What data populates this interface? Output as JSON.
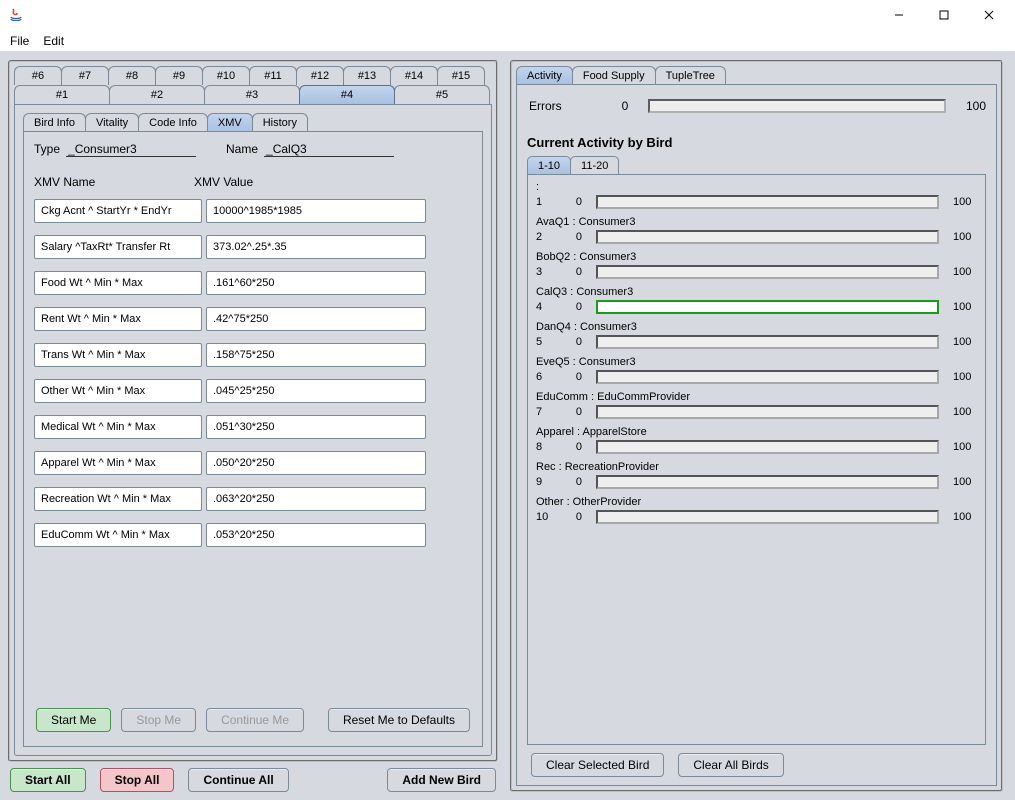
{
  "menu": {
    "file": "File",
    "edit": "Edit"
  },
  "numTabsTop": [
    "#6",
    "#7",
    "#8",
    "#9",
    "#10",
    "#11",
    "#12",
    "#13",
    "#14",
    "#15"
  ],
  "numTabsBottom": [
    "#1",
    "#2",
    "#3",
    "#4",
    "#5"
  ],
  "numTabsSelected": "#4",
  "subtabs": [
    "Bird Info",
    "Vitality",
    "Code Info",
    "XMV",
    "History"
  ],
  "subtabSelected": "XMV",
  "meta": {
    "typeLabel": "Type",
    "typeValue": "_Consumer3",
    "nameLabel": "Name",
    "nameValue": "_CalQ3"
  },
  "xmvHead": {
    "name": "XMV Name",
    "value": "XMV Value"
  },
  "xmv": [
    {
      "name": "Ckg Acnt ^ StartYr * EndYr",
      "value": "10000^1985*1985"
    },
    {
      "name": "Salary ^TaxRt* Transfer Rt",
      "value": "373.02^.25*.35"
    },
    {
      "name": "Food Wt ^ Min * Max",
      "value": ".161^60*250"
    },
    {
      "name": "Rent Wt ^ Min * Max",
      "value": ".42^75*250"
    },
    {
      "name": "Trans Wt ^ Min * Max",
      "value": ".158^75*250"
    },
    {
      "name": "Other Wt ^ Min * Max",
      "value": ".045^25*250"
    },
    {
      "name": "Medical Wt ^ Min * Max",
      "value": ".051^30*250"
    },
    {
      "name": "Apparel Wt ^ Min * Max",
      "value": ".050^20*250"
    },
    {
      "name": "Recreation Wt ^ Min * Max",
      "value": ".063^20*250"
    },
    {
      "name": "EduComm Wt ^ Min * Max",
      "value": ".053^20*250"
    }
  ],
  "birdBtns": {
    "start": "Start Me",
    "stop": "Stop Me",
    "cont": "Continue Me",
    "reset": "Reset Me to Defaults"
  },
  "globalBtns": {
    "startAll": "Start All",
    "stopAll": "Stop All",
    "contAll": "Continue All",
    "add": "Add New Bird"
  },
  "rightTabs": [
    "Activity",
    "Food Supply",
    "TupleTree"
  ],
  "rightTabSelected": "Activity",
  "errors": {
    "label": "Errors",
    "low": "0",
    "high": "100"
  },
  "activityHead": "Current Activity by Bird",
  "rangeTabs": [
    "1-10",
    "11-20"
  ],
  "rangeSelected": "1-10",
  "activity": [
    {
      "num": "1",
      "label": ":",
      "low": "0",
      "high": "100",
      "green": false
    },
    {
      "num": "2",
      "label": "AvaQ1 : Consumer3",
      "low": "0",
      "high": "100",
      "green": false
    },
    {
      "num": "3",
      "label": "BobQ2 : Consumer3",
      "low": "0",
      "high": "100",
      "green": false
    },
    {
      "num": "4",
      "label": "CalQ3 : Consumer3",
      "low": "0",
      "high": "100",
      "green": true
    },
    {
      "num": "5",
      "label": "DanQ4 : Consumer3",
      "low": "0",
      "high": "100",
      "green": false
    },
    {
      "num": "6",
      "label": "EveQ5 : Consumer3",
      "low": "0",
      "high": "100",
      "green": false
    },
    {
      "num": "7",
      "label": "EduComm : EduCommProvider",
      "low": "0",
      "high": "100",
      "green": false
    },
    {
      "num": "8",
      "label": "Apparel : ApparelStore",
      "low": "0",
      "high": "100",
      "green": false
    },
    {
      "num": "9",
      "label": "Rec : RecreationProvider",
      "low": "0",
      "high": "100",
      "green": false
    },
    {
      "num": "10",
      "label": "Other : OtherProvider",
      "low": "0",
      "high": "100",
      "green": false
    }
  ],
  "clearBtns": {
    "sel": "Clear Selected Bird",
    "all": "Clear All Birds"
  }
}
